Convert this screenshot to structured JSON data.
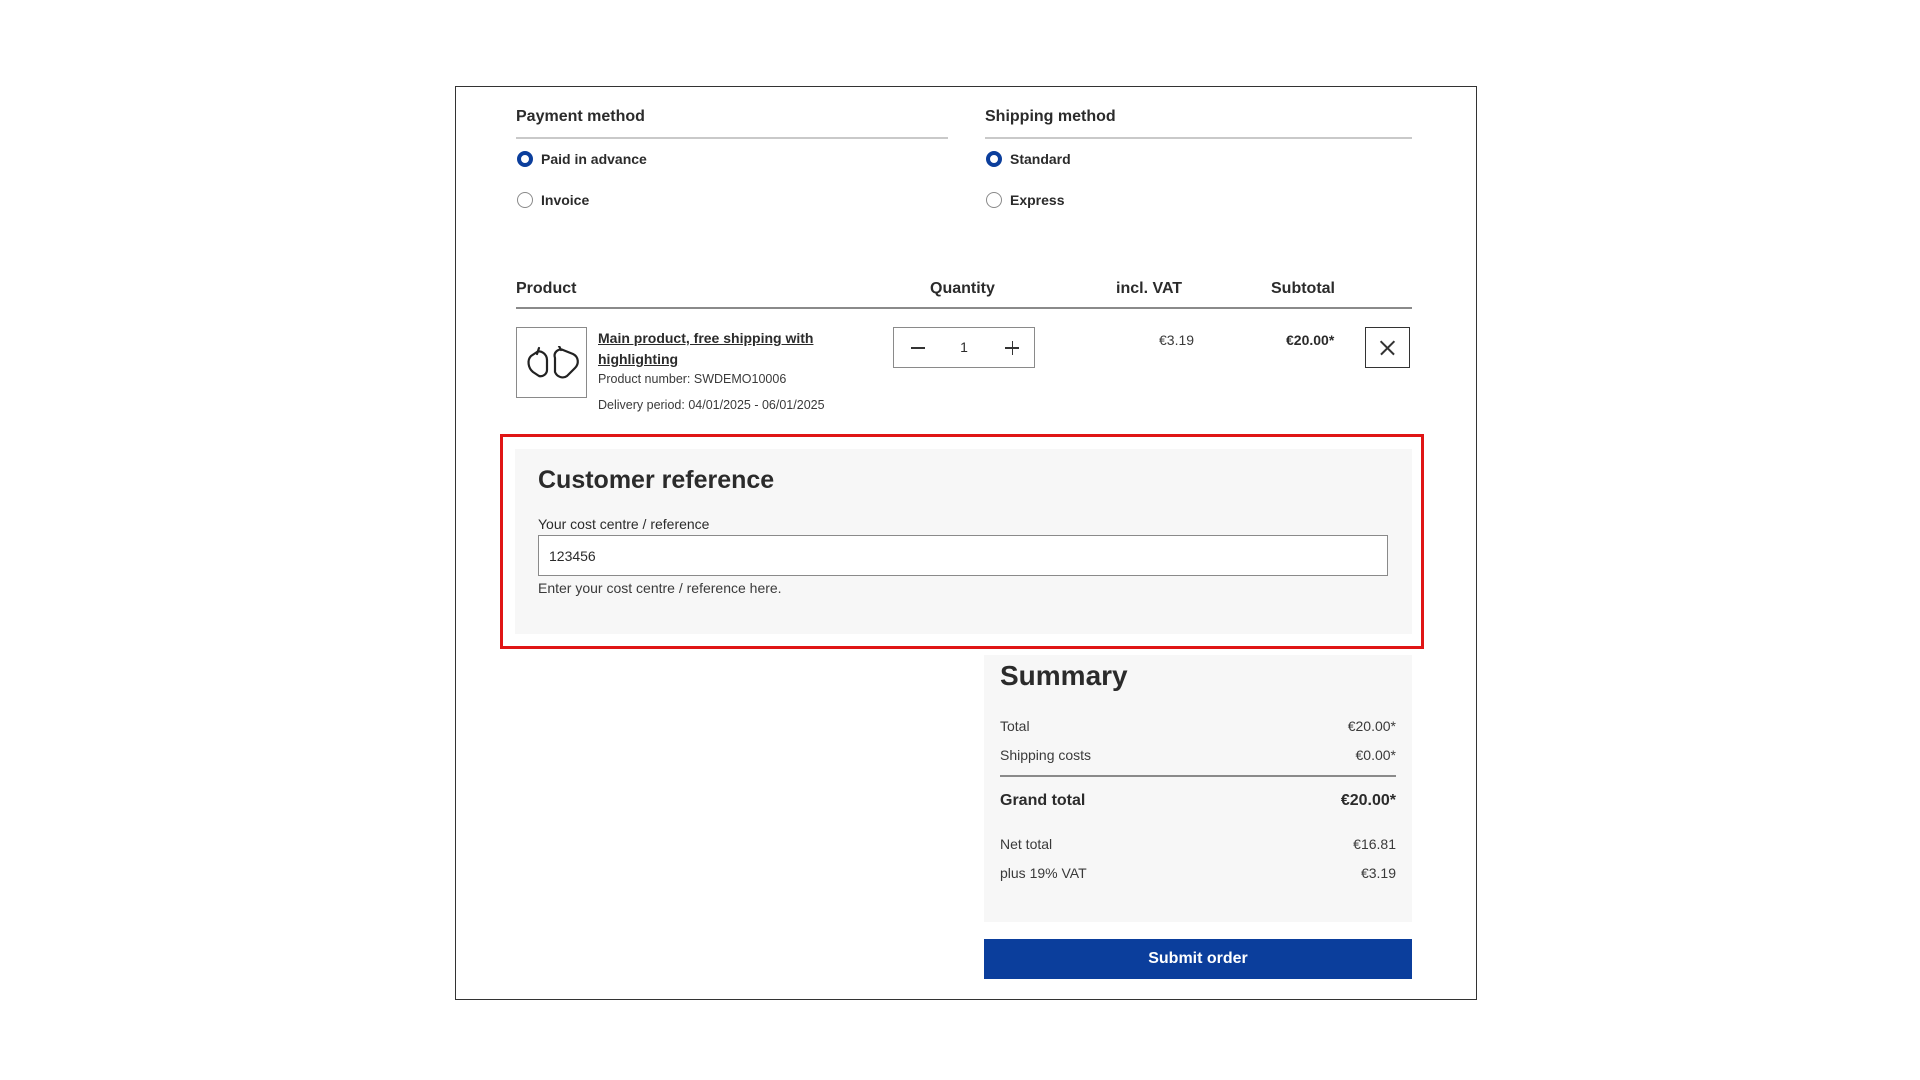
{
  "payment": {
    "heading": "Payment method",
    "options": [
      {
        "label": "Paid in advance",
        "checked": true
      },
      {
        "label": "Invoice",
        "checked": false
      }
    ]
  },
  "shipping": {
    "heading": "Shipping method",
    "options": [
      {
        "label": "Standard",
        "checked": true
      },
      {
        "label": "Express",
        "checked": false
      }
    ]
  },
  "cart": {
    "columns": {
      "product": "Product",
      "quantity": "Quantity",
      "vat": "incl. VAT",
      "subtotal": "Subtotal"
    },
    "item": {
      "name": "Main product, free shipping with highlighting",
      "product_number": "Product number: SWDEMO10006",
      "delivery": "Delivery period: 04/01/2025 - 06/01/2025",
      "quantity": "1",
      "vat": "€3.19",
      "subtotal": "€20.00*",
      "image_icon": "gloves-icon"
    }
  },
  "customer_reference": {
    "title": "Customer reference",
    "label": "Your cost centre / reference",
    "value": "123456",
    "help": "Enter your cost centre / reference here."
  },
  "summary": {
    "title": "Summary",
    "total_label": "Total",
    "total_value": "€20.00*",
    "shipping_label": "Shipping costs",
    "shipping_value": "€0.00*",
    "grand_label": "Grand total",
    "grand_value": "€20.00*",
    "net_label": "Net total",
    "net_value": "€16.81",
    "vat_label": "plus 19% VAT",
    "vat_value": "€3.19"
  },
  "submit_label": "Submit order",
  "colors": {
    "accent": "#0b3e9c",
    "highlight": "#e01515",
    "panel": "#f7f7f7"
  }
}
